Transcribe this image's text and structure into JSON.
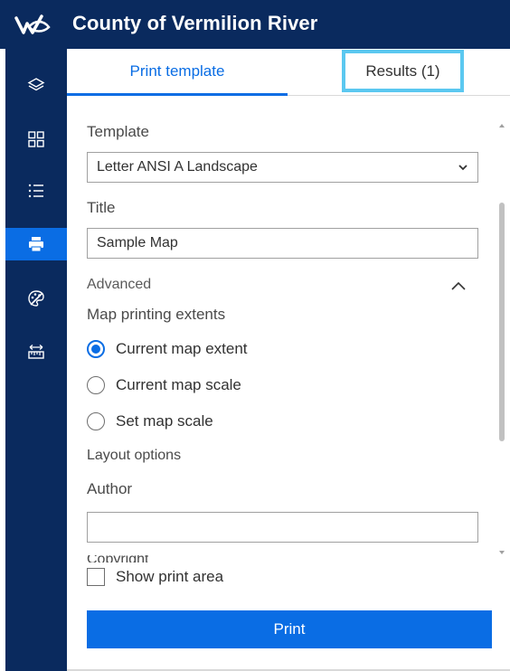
{
  "header": {
    "logo_icon": "county-logo-icon",
    "title": "County of Vermilion River",
    "background": "#0a2a5e"
  },
  "rail": {
    "items": [
      {
        "name": "layers-icon",
        "active": false
      },
      {
        "name": "grid-icon",
        "active": false
      },
      {
        "name": "list-icon",
        "active": false
      },
      {
        "name": "print-icon",
        "active": true
      },
      {
        "name": "palette-icon",
        "active": false
      },
      {
        "name": "measure-icon",
        "active": false
      }
    ],
    "active_color": "#0a6de4"
  },
  "tabs": {
    "print_template": "Print template",
    "results": "Results (1)"
  },
  "form": {
    "template_label": "Template",
    "template_value": "Letter ANSI A Landscape",
    "title_label": "Title",
    "title_value": "Sample Map",
    "advanced_label": "Advanced",
    "extents_label": "Map printing extents",
    "extent_options": [
      {
        "label": "Current map extent",
        "checked": true
      },
      {
        "label": "Current map scale",
        "checked": false
      },
      {
        "label": "Set map scale",
        "checked": false
      }
    ],
    "layout_label": "Layout options",
    "author_label": "Author",
    "author_value": "",
    "copyright_label": "Copyright"
  },
  "footer": {
    "show_print_area_label": "Show print area",
    "show_print_area_checked": false,
    "print_button": "Print"
  },
  "colors": {
    "accent": "#0a6de4",
    "highlight_border": "#5bc8f0"
  }
}
